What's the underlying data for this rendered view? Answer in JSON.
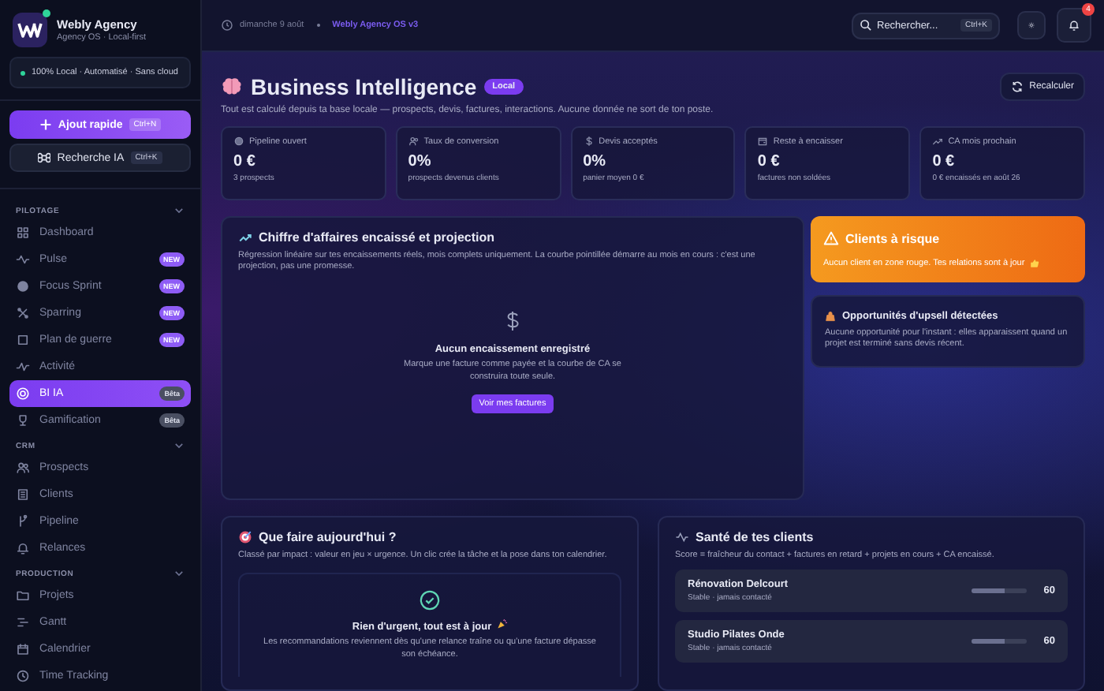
{
  "sidebar": {
    "brand": {
      "name": "Webly Agency",
      "tagline": "Agency OS · Local-first",
      "online": true
    },
    "status": "100% Local · Automatisé · Sans cloud",
    "quick_add": {
      "label": "Ajout rapide",
      "shortcut": "Ctrl+N"
    },
    "ai_search": {
      "label": "Recherche IA",
      "shortcut": "Ctrl+K"
    },
    "sections": [
      {
        "title": "PILOTAGE",
        "expanded": true,
        "items": [
          {
            "label": "Dashboard",
            "selected": false
          },
          {
            "label": "Pulse",
            "badge": {
              "text": "NEW",
              "kind": "new"
            },
            "selected": false
          },
          {
            "label": "Focus Sprint",
            "badge": {
              "text": "NEW",
              "kind": "new"
            },
            "selected": false
          },
          {
            "label": "Sparring",
            "badge": {
              "text": "NEW",
              "kind": "new"
            },
            "selected": false
          },
          {
            "label": "Plan de guerre",
            "badge": {
              "text": "NEW",
              "kind": "new"
            },
            "selected": false
          },
          {
            "label": "Activité",
            "selected": false
          },
          {
            "label": "BI IA",
            "badge": {
              "text": "Bêta",
              "kind": "beta"
            },
            "selected": true
          },
          {
            "label": "Gamification",
            "badge": {
              "text": "Bêta",
              "kind": "beta"
            },
            "selected": false
          }
        ]
      },
      {
        "title": "CRM",
        "expanded": true,
        "items": [
          {
            "label": "Prospects",
            "selected": false
          },
          {
            "label": "Clients",
            "selected": false
          },
          {
            "label": "Pipeline",
            "selected": false
          },
          {
            "label": "Relances",
            "selected": false
          }
        ]
      },
      {
        "title": "PRODUCTION",
        "expanded": true,
        "items": [
          {
            "label": "Projets",
            "selected": false
          },
          {
            "label": "Gantt",
            "selected": false
          },
          {
            "label": "Calendrier",
            "selected": false
          },
          {
            "label": "Time Tracking",
            "selected": false
          }
        ]
      }
    ]
  },
  "topbar": {
    "date": "dimanche 9 août",
    "version": "Webly Agency OS v3",
    "search": {
      "placeholder": "Rechercher...",
      "shortcut": "Ctrl+K"
    },
    "notifications": "4"
  },
  "header": {
    "title": "Business Intelligence",
    "badge": "Local",
    "subtitle": "Tout est calculé depuis ta base locale — prospects, devis, factures, interactions. Aucune donnée ne sort de ton poste.",
    "refresh": "Recalculer"
  },
  "kpis": [
    {
      "label": "Pipeline ouvert",
      "value": "0 €",
      "note": "3 prospects"
    },
    {
      "label": "Taux de conversion",
      "value": "0%",
      "note": "prospects devenus clients"
    },
    {
      "label": "Devis acceptés",
      "value": "0%",
      "note": "panier moyen 0 €"
    },
    {
      "label": "Reste à encaisser",
      "value": "0 €",
      "note": "factures non soldées"
    },
    {
      "label": "CA mois prochain",
      "value": "0 €",
      "note": "0 € encaissés en août 26"
    }
  ],
  "revenue": {
    "title": "Chiffre d'affaires encaissé et projection",
    "description": "Régression linéaire sur tes encaissements réels, mois complets uniquement. La courbe pointillée démarre au mois en cours : c'est une projection, pas une promesse.",
    "empty": {
      "title": "Aucun encaissement enregistré",
      "text": "Marque une facture comme payée et la courbe de CA se construira toute seule.",
      "action": "Voir mes factures"
    }
  },
  "risk": {
    "title": "Clients à risque",
    "text": "Aucun client en zone rouge. Tes relations sont à jour"
  },
  "upsell": {
    "title": "Opportunités d'upsell détectées",
    "text": "Aucune opportunité pour l'instant : elles apparaissent quand un projet est terminé sans devis récent."
  },
  "today": {
    "title": "Que faire aujourd'hui ?",
    "description": "Classé par impact : valeur en jeu × urgence. Un clic crée la tâche et la pose dans ton calendrier.",
    "empty": {
      "title": "Rien d'urgent, tout est à jour",
      "text": "Les recommandations reviennent dès qu'une relance traîne ou qu'une facture dépasse son échéance."
    }
  },
  "health": {
    "title": "Santé de tes clients",
    "description": "Score = fraîcheur du contact + factures en retard + projets en cours + CA encaissé.",
    "clients": [
      {
        "name": "Rénovation Delcourt",
        "status": "Stable · jamais contacté",
        "score": "60",
        "level": 0.6
      },
      {
        "name": "Studio Pilates Onde",
        "status": "Stable · jamais contacté",
        "score": "60",
        "level": 0.6
      }
    ]
  }
}
